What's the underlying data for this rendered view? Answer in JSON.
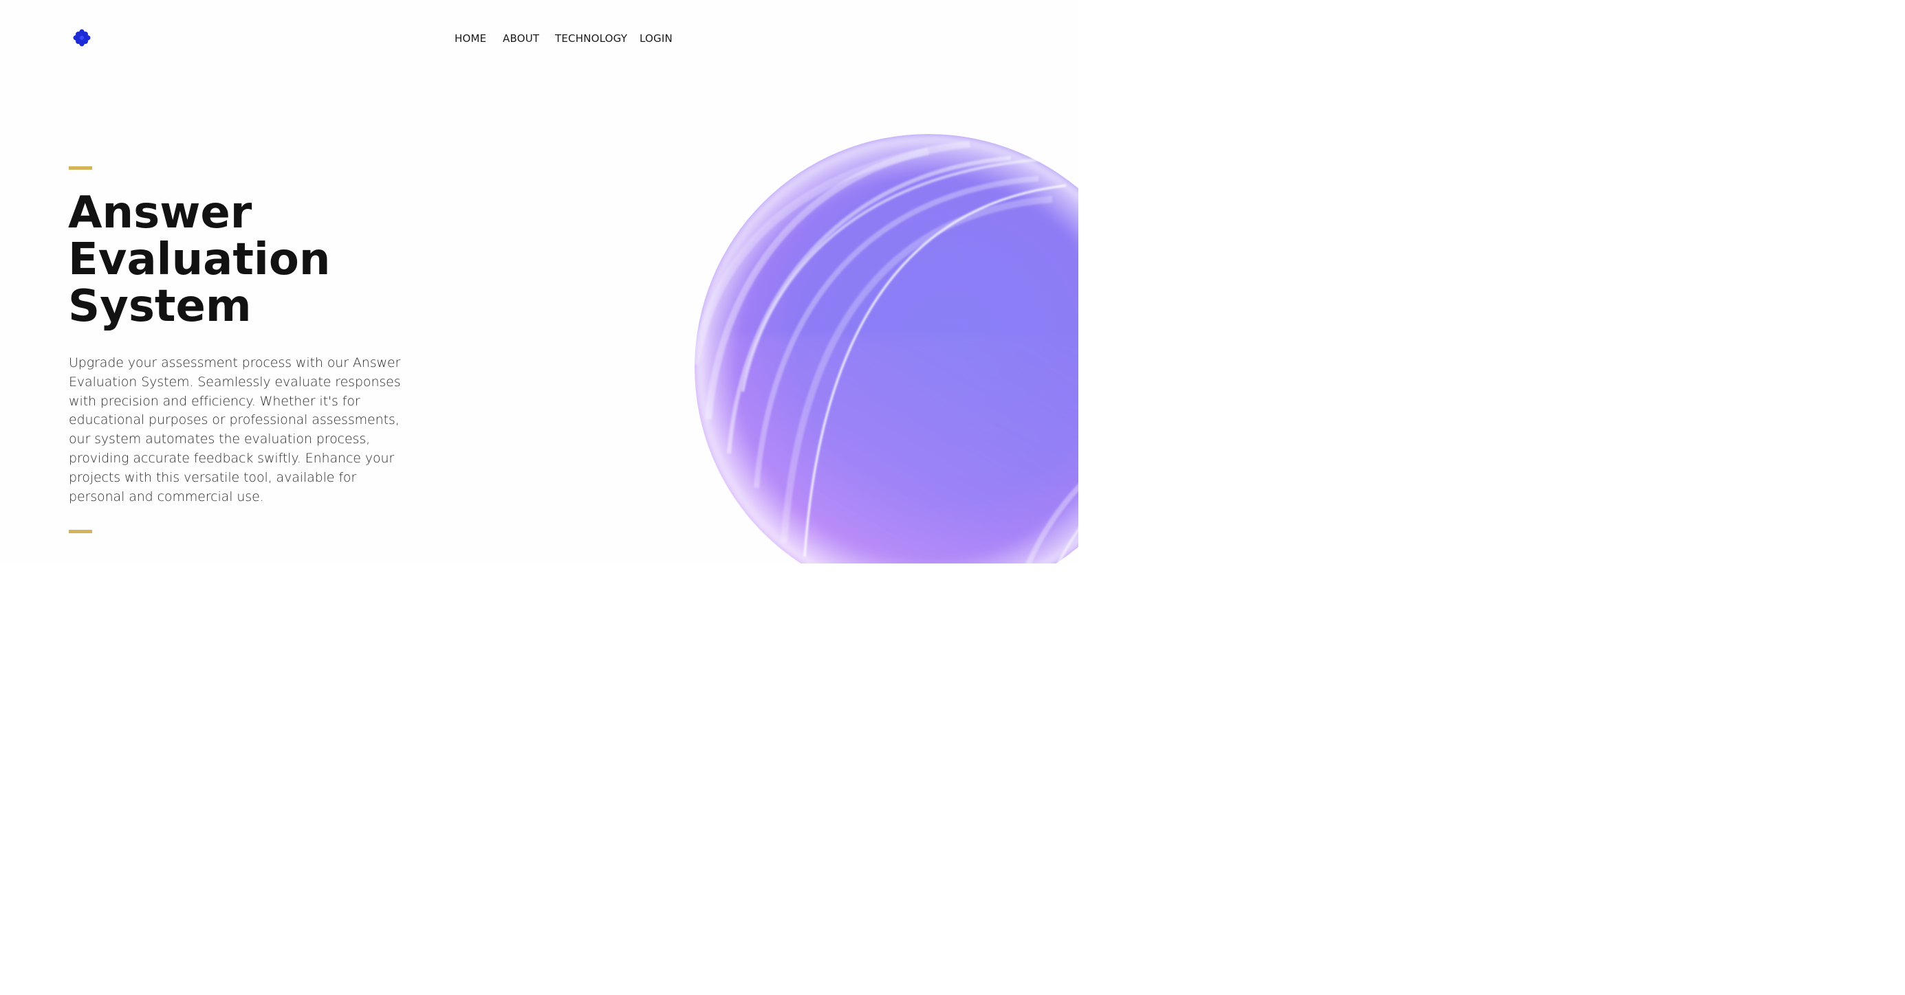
{
  "header": {
    "logo_icon": "flower-logo-icon",
    "logo_color": "#1c2bd6",
    "nav": [
      {
        "label": "HOME"
      },
      {
        "label": "ABOUT"
      },
      {
        "label": "TECHNOLOGY"
      },
      {
        "label": "LOGIN"
      }
    ]
  },
  "hero": {
    "title_lines": [
      "Answer",
      "Evaluation",
      "System"
    ],
    "description": "Upgrade your assessment process with our Answer Evaluation System. Seamlessly evaluate responses with precision and efficiency. Whether it's for educational purposes or professional assessments, our system automates the evaluation process, providing accurate feedback swiftly. Enhance your projects with this versatile tool, available for personal and commercial use.",
    "accent_color": "#d4b35b"
  },
  "decoration": {
    "sphere_icon": "gradient-sphere-graphic",
    "colors": [
      "#8b7ff5",
      "#a97cf6",
      "#d6a4fb"
    ]
  }
}
